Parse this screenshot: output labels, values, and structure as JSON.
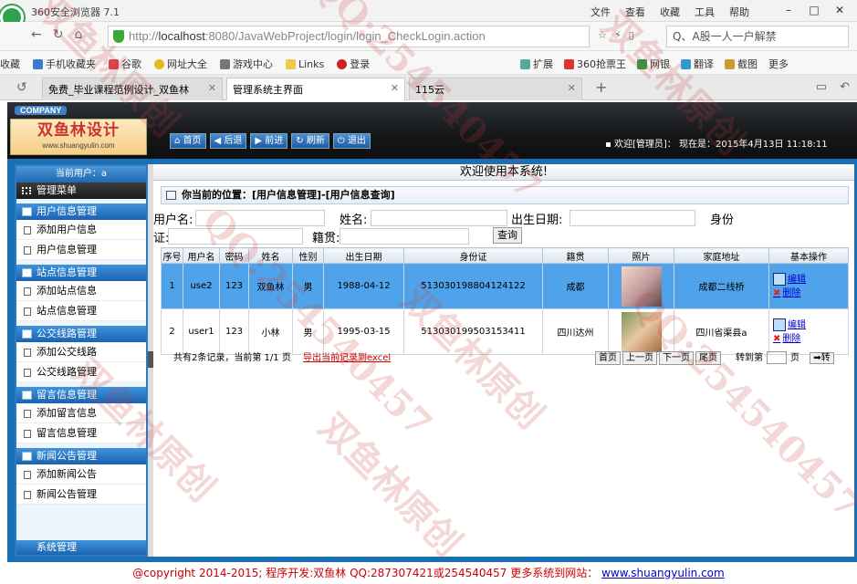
{
  "browser": {
    "title": "360安全浏览器 7.1",
    "menu": [
      "文件",
      "查看",
      "收藏",
      "工具",
      "帮助"
    ],
    "url_prefix": "http://",
    "url_host": "localhost",
    "url_path": ":8080/JavaWebProject/login/login_CheckLogin.action",
    "search": "Q、A股一人一户解禁",
    "bookmarks_left": [
      "收藏",
      "手机收藏夹",
      "谷歌",
      "网址大全",
      "游戏中心",
      "Links",
      "登录"
    ],
    "bookmarks_right": [
      "扩展",
      "360抢票王",
      "网银",
      "翻译",
      "截图",
      "更多"
    ],
    "tabs": [
      "免费_毕业课程范例设计_双鱼林",
      "管理系统主界面",
      "115云"
    ]
  },
  "header": {
    "company": "COMPANY",
    "brand_cn": "双鱼林设计",
    "brand_en": "www.shuangyulin.com",
    "nav": [
      "首页",
      "后退",
      "前进",
      "刷新",
      "退出"
    ],
    "welcome": "欢迎[管理员]： 现在是：2015年4月13日 11:18:11"
  },
  "sidebar": {
    "current_user": "当前用户：a",
    "main_menu": "管理菜单",
    "groups": [
      {
        "title": "用户信息管理",
        "items": [
          "添加用户信息",
          "用户信息管理"
        ]
      },
      {
        "title": "站点信息管理",
        "items": [
          "添加站点信息",
          "站点信息管理"
        ]
      },
      {
        "title": "公交线路管理",
        "items": [
          "添加公交线路",
          "公交线路管理"
        ]
      },
      {
        "title": "留言信息管理",
        "items": [
          "添加留言信息",
          "留言信息管理"
        ]
      },
      {
        "title": "新闻公告管理",
        "items": [
          "添加新闻公告",
          "新闻公告管理"
        ]
      }
    ],
    "system": "系统管理"
  },
  "content": {
    "welcome": "欢迎使用本系统!",
    "location": "你当前的位置：[用户信息管理]-[用户信息查询]",
    "labels": {
      "username": "用户名:",
      "name": "姓名:",
      "birthday": "出生日期:",
      "idcard1": "身份",
      "idcard2": "证:",
      "native": "籍贯:"
    },
    "search_button": "查询",
    "columns": [
      "序号",
      "用户名",
      "密码",
      "姓名",
      "性别",
      "出生日期",
      "身份证",
      "籍贯",
      "照片",
      "家庭地址",
      "基本操作"
    ],
    "rows": [
      [
        "1",
        "use2",
        "123",
        "双鱼林",
        "男",
        "1988-04-12",
        "513030198804124122",
        "成都",
        "",
        "成都二线桥"
      ],
      [
        "2",
        "user1",
        "123",
        "小林",
        "男",
        "1995-03-15",
        "513030199503153411",
        "四川达州",
        "",
        "四川省渠县a"
      ]
    ],
    "ops": {
      "edit": "编辑",
      "delete": "删除"
    },
    "pager": {
      "summary": "共有2条记录，当前第 1/1 页",
      "export": "导出当前记录到excel",
      "buttons": [
        "首页",
        "上一页",
        "下一页",
        "尾页"
      ],
      "goto": "转到第",
      "page": "页",
      "go": "转"
    }
  },
  "footer": {
    "text": "@copyright 2014-2015; 程序开发:双鱼林 QQ:287307421或254540457 更多系统到网站：",
    "site": "www.shuangyulin.com"
  },
  "watermark": {
    "lines": [
      "双鱼林原创",
      "QQ:254540457",
      "双鱼林原创",
      "QQ:254540457",
      "双鱼林原创",
      "双鱼林原创",
      "QQ:254540457",
      "双鱼林原创"
    ]
  },
  "colors": {
    "accent": "#1b6fb5",
    "selected_row": "#4fa3ea",
    "footer_text": "#c00000"
  }
}
